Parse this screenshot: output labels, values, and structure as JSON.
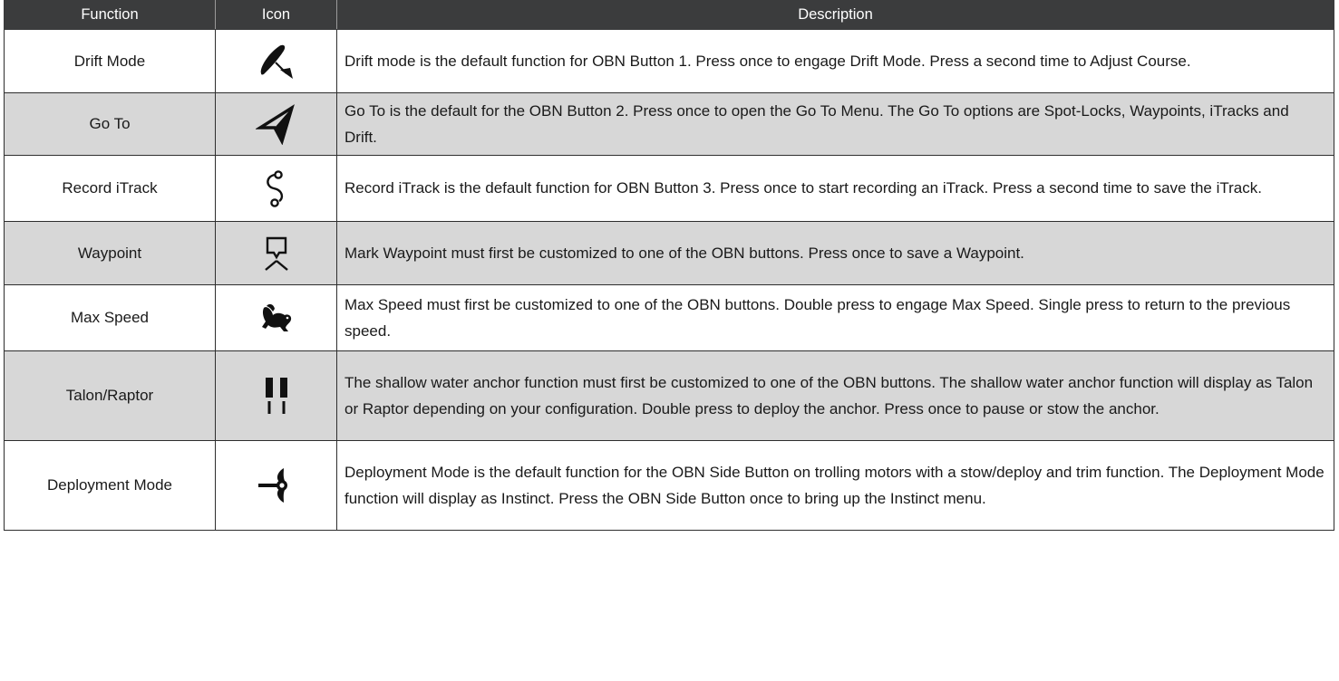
{
  "table": {
    "headers": {
      "function": "Function",
      "icon": "Icon",
      "description": "Description"
    },
    "rows": [
      {
        "function": "Drift Mode",
        "icon": "drift-mode-icon",
        "description": "Drift mode is the default function for OBN Button 1. Press once to engage Drift Mode. Press a second time to Adjust Course."
      },
      {
        "function": "Go To",
        "icon": "go-to-arrow-icon",
        "description": "Go To is the default for the OBN Button 2. Press once to open the Go To Menu. The Go To options are Spot-Locks, Waypoints, iTracks and Drift."
      },
      {
        "function": "Record iTrack",
        "icon": "record-itrack-icon",
        "description": "Record iTrack is the default function for OBN Button 3. Press once to start recording an iTrack. Press a second time to save the iTrack."
      },
      {
        "function": "Waypoint",
        "icon": "waypoint-icon",
        "description": "Mark Waypoint must first be customized to one of the OBN buttons. Press once to save a Waypoint."
      },
      {
        "function": "Max Speed",
        "icon": "rabbit-icon",
        "description": "Max Speed must first be customized to one of the OBN buttons. Double press to engage Max Speed. Single press to return to the previous speed."
      },
      {
        "function": "Talon/Raptor",
        "icon": "shallow-water-anchor-icon",
        "description": "The shallow water anchor function must first be customized to one of the OBN buttons. The shallow water anchor function will display as Talon or Raptor depending on your configuration. Double press to deploy the anchor. Press once to pause or stow the anchor."
      },
      {
        "function": "Deployment Mode",
        "icon": "deployment-motor-icon",
        "description": "Deployment Mode is the default function for the OBN Side Button on trolling motors with a stow/deploy and trim function. The Deployment Mode function will display as Instinct. Press the OBN Side Button once to bring up the Instinct menu."
      }
    ]
  },
  "colors": {
    "header_bg": "#3b3c3d",
    "header_text": "#ffffff",
    "row_shade": "#d7d7d7",
    "border": "#2e2e2e"
  }
}
